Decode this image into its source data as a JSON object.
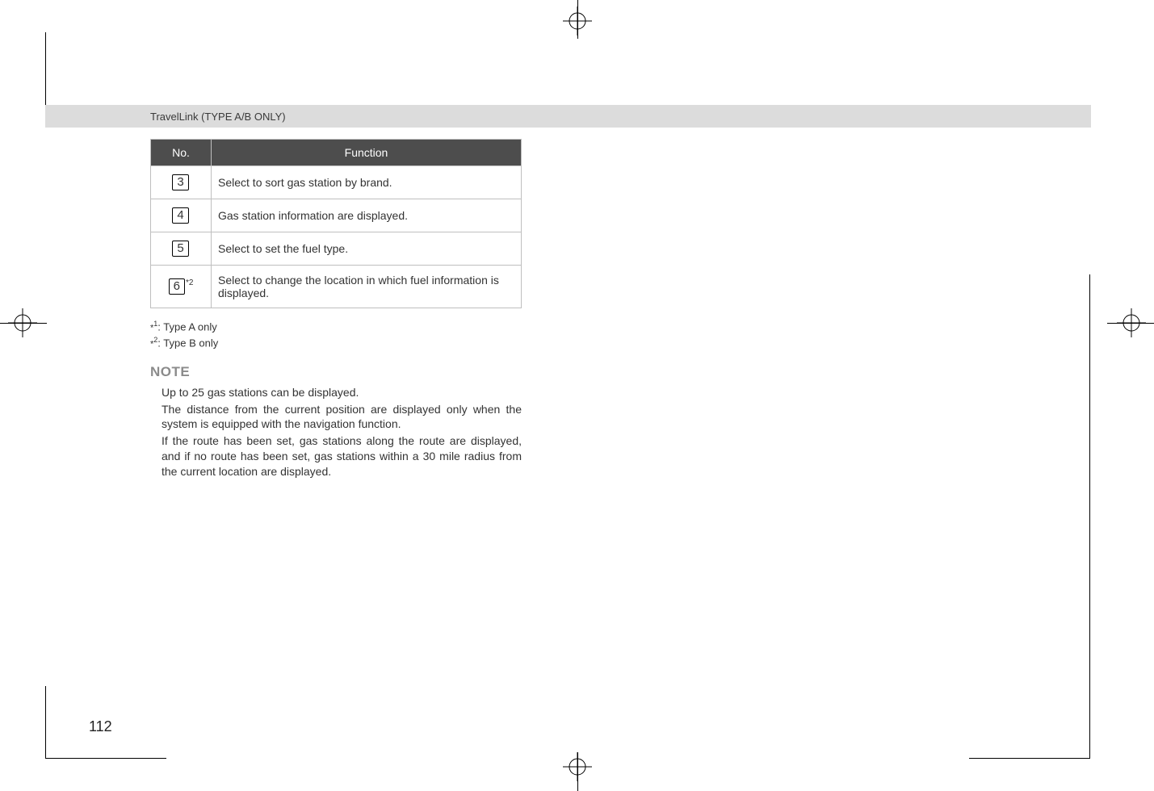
{
  "header": {
    "title": "TravelLink (TYPE A/B ONLY)"
  },
  "table": {
    "headers": {
      "no": "No.",
      "function": "Function"
    },
    "rows": [
      {
        "num": "3",
        "sup": "",
        "func": "Select to sort gas station by brand."
      },
      {
        "num": "4",
        "sup": "",
        "func": "Gas station information are displayed."
      },
      {
        "num": "5",
        "sup": "",
        "func": "Select to set the fuel type."
      },
      {
        "num": "6",
        "sup": "*2",
        "func": "Select to change the location in which fuel information is displayed."
      }
    ]
  },
  "footnotes": {
    "f1": {
      "mark": "*",
      "sup": "1",
      "text": ":  Type A only"
    },
    "f2": {
      "mark": "*",
      "sup": "2",
      "text": ":  Type B only"
    }
  },
  "note": {
    "heading": "NOTE",
    "lines": [
      "Up to 25 gas stations can be displayed.",
      "The distance from the current position are displayed only when the system is equipped with the navigation function.",
      "If the route has been set, gas stations along the route are displayed, and if no route has been set, gas stations within a 30 mile radius from the current location are displayed."
    ]
  },
  "page_number": "112"
}
